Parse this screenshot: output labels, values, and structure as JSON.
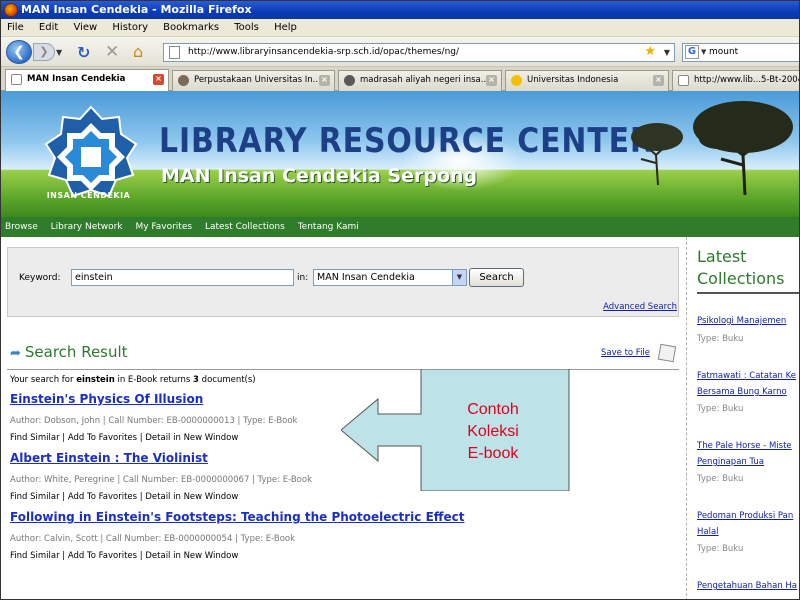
{
  "window": {
    "title": "MAN Insan Cendekia - Mozilla Firefox"
  },
  "menu": [
    "File",
    "Edit",
    "View",
    "History",
    "Bookmarks",
    "Tools",
    "Help"
  ],
  "toolbar": {
    "url": "http://www.libraryinsancendekia-srp.sch.id/opac/themes/ng/",
    "search_value": "mount"
  },
  "tabs": [
    {
      "label": "MAN Insan Cendekia",
      "active": true
    },
    {
      "label": "Perpustakaan Universitas In...",
      "active": false
    },
    {
      "label": "madrasah aliyah negeri insa...",
      "active": false
    },
    {
      "label": "Universitas Indonesia",
      "active": false
    },
    {
      "label": "http://www.lib...5-Bt-2004",
      "active": false
    }
  ],
  "banner": {
    "logo_text": "INSAN CENDEKIA",
    "title": "LIBRARY RESOURCE CENTER",
    "subtitle": "MAN Insan Cendekia Serpong"
  },
  "sitenav": [
    "Browse",
    "Library Network",
    "My Favorites",
    "Latest Collections",
    "Tentang Kami"
  ],
  "search": {
    "keyword_label": "Keyword:",
    "keyword_value": "einstein",
    "in_label": "in:",
    "collection": "MAN Insan Cendekia",
    "button": "Search",
    "advanced": "Advanced Search"
  },
  "results": {
    "title": "Search Result",
    "save": "Save to File",
    "summary_pre": "Your search for ",
    "summary_term": "einstein",
    "summary_mid": " in E-Book returns ",
    "summary_count": "3",
    "summary_post": " document(s)",
    "items": [
      {
        "title": "Einstein's Physics Of Illusion",
        "meta": "Author: Dobson, John  | Call Number: EB-0000000013 | Type: E-Book"
      },
      {
        "title": "Albert Einstein : The Violinist",
        "meta": "Author: White, Peregrine  | Call Number: EB-0000000067 | Type: E-Book"
      },
      {
        "title": "Following in Einstein's Footsteps: Teaching the Photoelectric Effect",
        "meta": "Author: Calvin, Scott  | Call Number: EB-0000000054 | Type: E-Book"
      }
    ],
    "links": [
      "Find Similar",
      "Add To Favorites",
      "Detail in New Window"
    ]
  },
  "sidebar": {
    "title_line1": "Latest",
    "title_line2": "Collections",
    "items": [
      {
        "line1": "Psikologi Manajemen",
        "line2": "",
        "type": "Type: Buku"
      },
      {
        "line1": "Fatmawati : Catatan Ke",
        "line2": "Bersama Bung Karno",
        "type": "Type: Buku"
      },
      {
        "line1": "The Pale Horse - Miste",
        "line2": "Penginapan Tua",
        "type": "Type: Buku"
      },
      {
        "line1": "Pedoman Produksi Pan",
        "line2": "Halal",
        "type": "Type: Buku"
      },
      {
        "line1": "Pengetahuan Bahan Ha",
        "line2": "",
        "type": ""
      }
    ]
  },
  "callout": {
    "line1": "Contoh",
    "line2": "Koleksi",
    "line3": "E-book"
  },
  "colors": {
    "accent_green": "#2c7a2c",
    "link_blue": "#1a2ec8",
    "callout_fill": "#bde3e8",
    "callout_text": "#e0001a"
  }
}
